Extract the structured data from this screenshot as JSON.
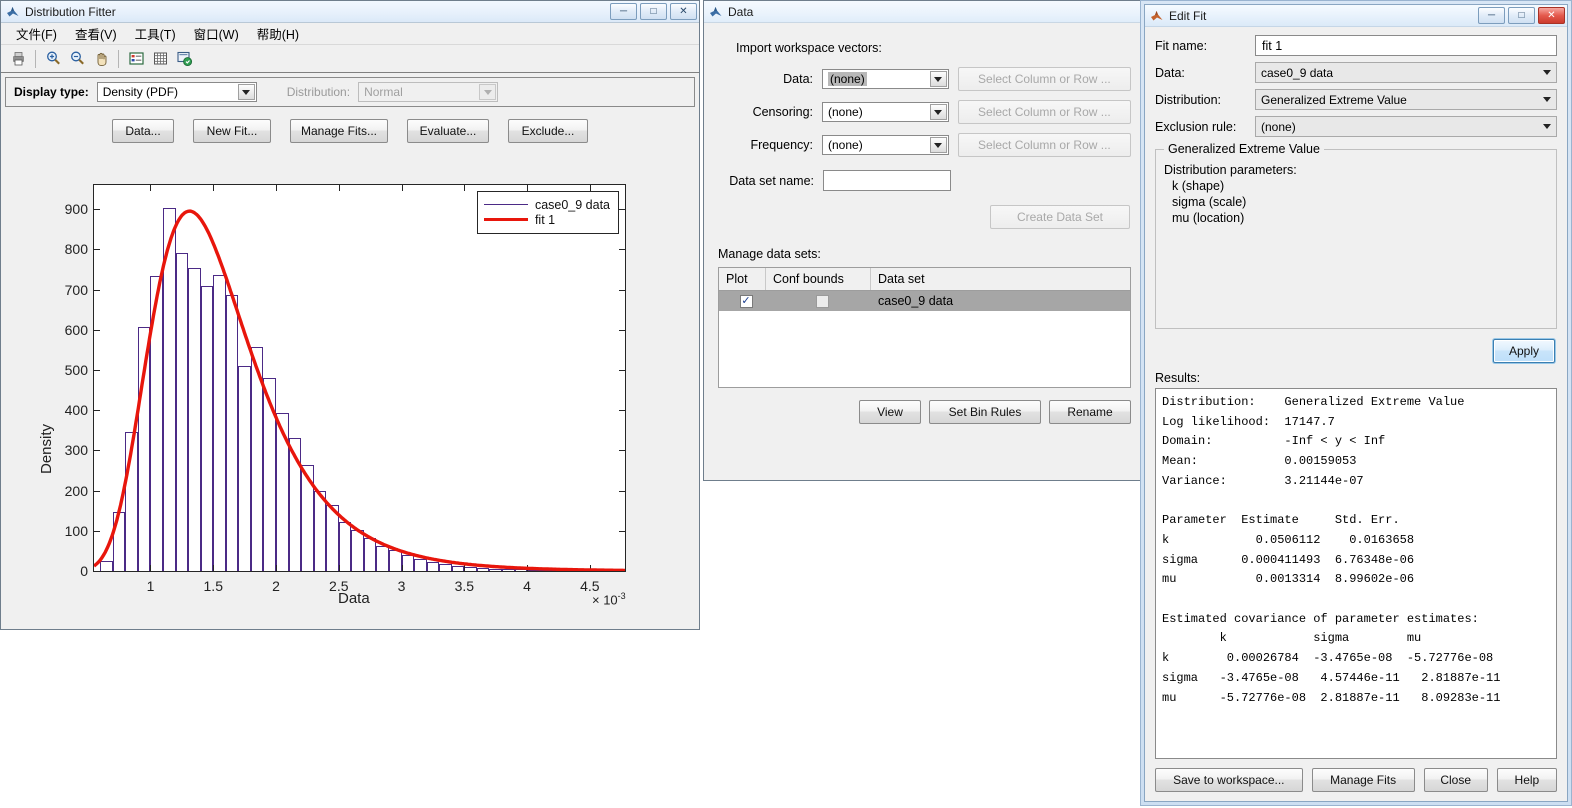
{
  "distribution_fitter": {
    "title": "Distribution Fitter",
    "menu": [
      "文件(F)",
      "查看(V)",
      "工具(T)",
      "窗口(W)",
      "帮助(H)"
    ],
    "toolbar_icons": [
      "print-icon",
      "zoom-in-icon",
      "zoom-out-icon",
      "pan-icon",
      "legend-icon",
      "grid-icon",
      "copy-figure-icon"
    ],
    "display_type_label": "Display type:",
    "display_type_value": "Density (PDF)",
    "distribution_label": "Distribution:",
    "distribution_value": "Normal",
    "buttons": [
      "Data...",
      "New Fit...",
      "Manage Fits...",
      "Evaluate...",
      "Exclude..."
    ],
    "window_controls": [
      "minimize",
      "maximize",
      "close"
    ]
  },
  "chart_data": {
    "type": "bar",
    "title": "",
    "xlabel": "Data",
    "ylabel": "Density",
    "x_exponent": "× 10",
    "x_exponent_sup": "-3",
    "xlim": [
      0.55,
      4.78
    ],
    "ylim": [
      0,
      960
    ],
    "xticks": [
      1,
      1.5,
      2,
      2.5,
      3,
      3.5,
      4,
      4.5
    ],
    "yticks": [
      0,
      100,
      200,
      300,
      400,
      500,
      600,
      700,
      800,
      900
    ],
    "grid": false,
    "legend_position": "top-right",
    "legend": [
      {
        "label": "case0_9 data",
        "color": "#4b2a86",
        "width": 1
      },
      {
        "label": "fit 1",
        "color": "#e8160c",
        "width": 3
      }
    ],
    "bin_edges": [
      0.6,
      0.7,
      0.8,
      0.9,
      1.0,
      1.1,
      1.2,
      1.3,
      1.4,
      1.5,
      1.6,
      1.7,
      1.8,
      1.9,
      2.0,
      2.1,
      2.2,
      2.3,
      2.4,
      2.5,
      2.6,
      2.7,
      2.8,
      2.9,
      3.0,
      3.1,
      3.2,
      3.3,
      3.4,
      3.5,
      3.6,
      3.7,
      3.8,
      3.9,
      4.0,
      4.1,
      4.2,
      4.3,
      4.4,
      4.5,
      4.6,
      4.7
    ],
    "values": [
      26,
      148,
      345,
      608,
      733,
      903,
      790,
      754,
      708,
      736,
      686,
      510,
      556,
      480,
      392,
      332,
      263,
      200,
      164,
      122,
      102,
      83,
      61,
      53,
      40,
      30,
      22,
      18,
      13,
      10,
      8,
      6,
      5,
      4,
      3,
      2,
      2,
      1,
      1,
      1,
      0
    ],
    "fit_curve": {
      "name": "fit 1",
      "distribution": "Generalized Extreme Value",
      "k": 0.0506112,
      "sigma": 0.000411493,
      "mu": 0.0013314,
      "scale": 1.0,
      "peak_value": 895
    }
  },
  "data_window": {
    "title": "Data",
    "import_header": "Import workspace vectors:",
    "fields": [
      {
        "label": "Data:",
        "value": "(none)",
        "button": "Select Column or Row ...",
        "selected": true
      },
      {
        "label": "Censoring:",
        "value": "(none)",
        "button": "Select Column or Row ...",
        "selected": false
      },
      {
        "label": "Frequency:",
        "value": "(none)",
        "button": "Select Column or Row ...",
        "selected": false
      }
    ],
    "data_set_name_label": "Data set name:",
    "data_set_name_value": "",
    "create_button": "Create Data Set",
    "manage_label": "Manage data sets:",
    "table": {
      "columns": [
        "Plot",
        "Conf bounds",
        "Data set"
      ],
      "rows": [
        {
          "plot": true,
          "conf_bounds": false,
          "data_set": "case0_9 data",
          "selected": true
        }
      ]
    },
    "table_buttons": [
      "View",
      "Set Bin Rules",
      "Rename"
    ]
  },
  "edit_fit": {
    "title": "Edit Fit",
    "window_controls": [
      "minimize",
      "maximize",
      "close"
    ],
    "fit_name_label": "Fit name:",
    "fit_name_value": "fit 1",
    "data_label": "Data:",
    "data_value": "case0_9 data",
    "distribution_label": "Distribution:",
    "distribution_value": "Generalized Extreme Value",
    "exclusion_label": "Exclusion rule:",
    "exclusion_value": "(none)",
    "param_frame_title": "Generalized Extreme Value",
    "param_header": "Distribution parameters:",
    "params": [
      "k (shape)",
      "sigma (scale)",
      "mu (location)"
    ],
    "apply_button": "Apply",
    "results_label": "Results:",
    "results_text": "Distribution:    Generalized Extreme Value\nLog likelihood:  17147.7\nDomain:          -Inf < y < Inf\nMean:            0.00159053\nVariance:        3.21144e-07\n\nParameter  Estimate     Std. Err.\nk            0.0506112    0.0163658\nsigma      0.000411493  6.76348e-06\nmu           0.0013314  8.99602e-06\n\nEstimated covariance of parameter estimates:\n        k            sigma        mu\nk        0.00026784  -3.4765e-08  -5.72776e-08\nsigma   -3.4765e-08   4.57446e-11   2.81887e-11\nmu      -5.72776e-08  2.81887e-11   8.09283e-11",
    "bottom_buttons": [
      "Save to workspace...",
      "Manage Fits",
      "Close",
      "Help"
    ]
  },
  "colors": {
    "hist_edge": "#4b2a86",
    "fit_line": "#e8160c",
    "window_bg": "#f0f0f0",
    "title_blue": "#dbeaf8"
  }
}
